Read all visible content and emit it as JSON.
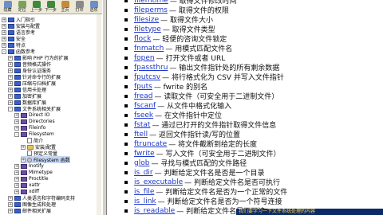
{
  "toolbar": {
    "buttons": [
      {
        "label": "隐藏",
        "icon": "hide-icon",
        "color": "#6d8fc7"
      },
      {
        "label": "定位",
        "icon": "locate-icon",
        "color": "#7aa35a"
      },
      {
        "label": "上一步",
        "icon": "back-icon",
        "color": "#3d8a3d"
      },
      {
        "label": "下一步",
        "icon": "forward-icon",
        "color": "#3d8a3d"
      },
      {
        "label": "主页",
        "icon": "home-icon",
        "color": "#c58a3a"
      },
      {
        "label": "打印",
        "icon": "print-icon",
        "color": "#8a8a8a"
      },
      {
        "label": "选项",
        "icon": "options-icon",
        "color": "#6d8fc7"
      }
    ]
  },
  "tree": [
    {
      "label": "入门指引",
      "expander": "+",
      "icon": "blue",
      "indent": 2,
      "selected": false
    },
    {
      "label": "安装与配置",
      "expander": "+",
      "icon": "blue",
      "indent": 2,
      "selected": false
    },
    {
      "label": "语言参考",
      "expander": "+",
      "icon": "blue",
      "indent": 2,
      "selected": false
    },
    {
      "label": "安全",
      "expander": "+",
      "icon": "blue",
      "indent": 2,
      "selected": false
    },
    {
      "label": "特点",
      "expander": "+",
      "icon": "blue",
      "indent": 2,
      "selected": false
    },
    {
      "label": "函数参考",
      "expander": "-",
      "icon": "blue",
      "indent": 2,
      "selected": false
    },
    {
      "label": "影响 PHP 行为的扩展",
      "expander": "+",
      "icon": "blue",
      "indent": 10,
      "selected": false
    },
    {
      "label": "音频格式操作",
      "expander": "+",
      "icon": "blue",
      "indent": 10,
      "selected": false
    },
    {
      "label": "身份认证服务",
      "expander": "+",
      "icon": "blue",
      "indent": 10,
      "selected": false
    },
    {
      "label": "针对命令行的扩展",
      "expander": "+",
      "icon": "blue",
      "indent": 10,
      "selected": false
    },
    {
      "label": "压缩与归档扩展",
      "expander": "+",
      "icon": "blue",
      "indent": 10,
      "selected": false
    },
    {
      "label": "信用卡处理",
      "expander": "+",
      "icon": "blue",
      "indent": 10,
      "selected": false
    },
    {
      "label": "加密扩展",
      "expander": "+",
      "icon": "blue",
      "indent": 10,
      "selected": false
    },
    {
      "label": "数据库扩展",
      "expander": "+",
      "icon": "blue",
      "indent": 10,
      "selected": false
    },
    {
      "label": "文件系统相关扩展",
      "expander": "-",
      "icon": "blue",
      "indent": 10,
      "selected": false
    },
    {
      "label": "Direct IO",
      "expander": "+",
      "icon": "purple",
      "indent": 18,
      "selected": false
    },
    {
      "label": "Directories",
      "expander": "+",
      "icon": "purple",
      "indent": 18,
      "selected": false
    },
    {
      "label": "Fileinfo",
      "expander": "+",
      "icon": "purple",
      "indent": 18,
      "selected": false
    },
    {
      "label": "Filesystem",
      "expander": "-",
      "icon": "purple",
      "indent": 18,
      "selected": false
    },
    {
      "label": "简介",
      "expander": "",
      "icon": "page",
      "indent": 26,
      "selected": false
    },
    {
      "label": "安装/配置",
      "expander": "+",
      "icon": "folder",
      "indent": 26,
      "selected": false
    },
    {
      "label": "预定义常量",
      "expander": "",
      "icon": "page",
      "indent": 26,
      "selected": false
    },
    {
      "label": "Filesystem 函数",
      "expander": "+",
      "icon": "gear",
      "indent": 26,
      "selected": true
    },
    {
      "label": "Inotify",
      "expander": "+",
      "icon": "purple",
      "indent": 18,
      "selected": false
    },
    {
      "label": "Mimetype",
      "expander": "+",
      "icon": "purple",
      "indent": 18,
      "selected": false
    },
    {
      "label": "Proctitle",
      "expander": "+",
      "icon": "purple",
      "indent": 18,
      "selected": false
    },
    {
      "label": "xattr",
      "expander": "+",
      "icon": "purple",
      "indent": 18,
      "selected": false
    },
    {
      "label": "xdiff",
      "expander": "+",
      "icon": "purple",
      "indent": 18,
      "selected": false
    },
    {
      "label": "人类语言和字符编码支持",
      "expander": "+",
      "icon": "blue",
      "indent": 10,
      "selected": false
    },
    {
      "label": "图像生成和处理",
      "expander": "+",
      "icon": "blue",
      "indent": 10,
      "selected": false
    },
    {
      "label": "邮件相关扩展",
      "expander": "+",
      "icon": "blue",
      "indent": 10,
      "selected": false
    }
  ],
  "functions": [
    {
      "name": "filemtime",
      "desc": "— 取得文件修改时间"
    },
    {
      "name": "fileperms",
      "desc": "— 取得文件的权限"
    },
    {
      "name": "filesize",
      "desc": "— 取得文件大小"
    },
    {
      "name": "filetype",
      "desc": "— 取得文件类型"
    },
    {
      "name": "flock",
      "desc": "— 轻便的咨询文件锁定"
    },
    {
      "name": "fnmatch",
      "desc": "— 用模式匹配文件名"
    },
    {
      "name": "fopen",
      "desc": "— 打开文件或者 URL"
    },
    {
      "name": "fpassthru",
      "desc": "— 输出文件指针处的所有剩余数据"
    },
    {
      "name": "fputcsv",
      "desc": "— 将行格式化为 CSV 并写入文件指针"
    },
    {
      "name": "fputs",
      "desc": "— fwrite 的别名"
    },
    {
      "name": "fread",
      "desc": "— 读取文件（可安全用于二进制文件）"
    },
    {
      "name": "fscanf",
      "desc": "— 从文件中格式化输入"
    },
    {
      "name": "fseek",
      "desc": "— 在文件指针中定位"
    },
    {
      "name": "fstat",
      "desc": "— 通过已打开的文件指针取得文件信息"
    },
    {
      "name": "ftell",
      "desc": "— 返回文件指针读/写的位置"
    },
    {
      "name": "ftruncate",
      "desc": "— 将文件截断到给定的长度"
    },
    {
      "name": "fwrite",
      "desc": "— 写入文件（可安全用于二进制文件）"
    },
    {
      "name": "glob",
      "desc": "— 寻找与模式匹配的文件路径"
    },
    {
      "name": "is_dir",
      "desc": "— 判断给定文件名是否是一个目录"
    },
    {
      "name": "is_executable",
      "desc": "— 判断给定文件名是否可执行"
    },
    {
      "name": "is_file",
      "desc": "— 判断给定文件名是否为一个正常的文件"
    },
    {
      "name": "is_link",
      "desc": "— 判断给定文件名是否为一个符号连接"
    },
    {
      "name": "is_readable",
      "desc": "— 判断给定文件名是否可读"
    }
  ],
  "caption": "我们要学习一下文件系统处理的内容"
}
